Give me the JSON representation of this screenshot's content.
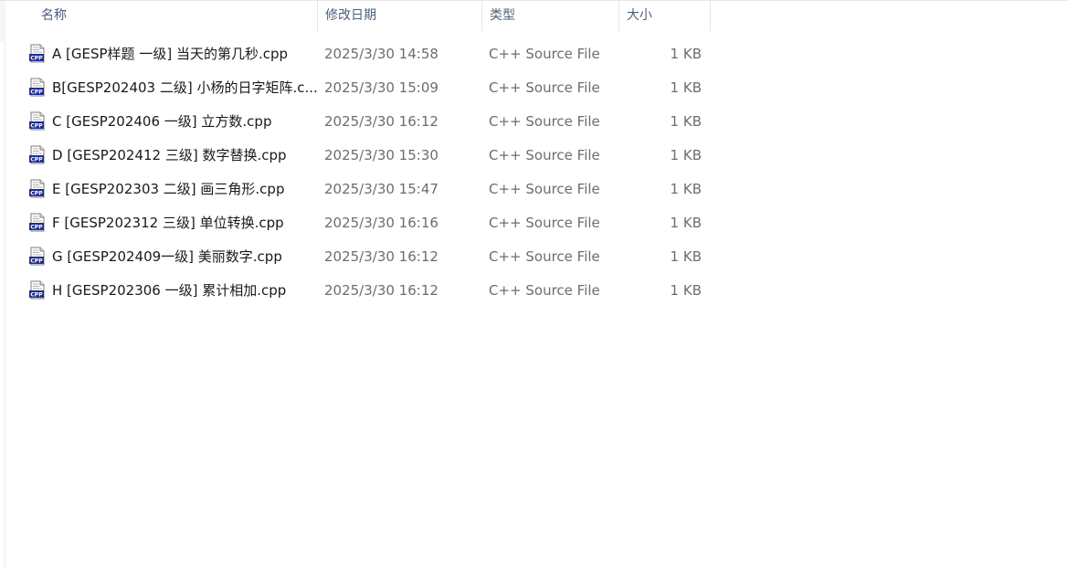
{
  "columns": {
    "name": "名称",
    "date": "修改日期",
    "type": "类型",
    "size": "大小"
  },
  "icons": {
    "file": "cpp-file-icon",
    "sort": "sort-ascending-icon"
  },
  "colors": {
    "header_text": "#4c607a",
    "name_text": "#1a1a1a",
    "meta_text": "#6d6d6d",
    "icon_badge": "#1f2f8f"
  },
  "files": [
    {
      "name": "A [GESP样题 一级] 当天的第几秒.cpp",
      "date": "2025/3/30 14:58",
      "type": "C++ Source File",
      "size": "1 KB"
    },
    {
      "name": "B[GESP202403 二级] 小杨的日字矩阵.c...",
      "date": "2025/3/30 15:09",
      "type": "C++ Source File",
      "size": "1 KB"
    },
    {
      "name": "C [GESP202406 一级] 立方数.cpp",
      "date": "2025/3/30 16:12",
      "type": "C++ Source File",
      "size": "1 KB"
    },
    {
      "name": "D [GESP202412 三级] 数字替换.cpp",
      "date": "2025/3/30 15:30",
      "type": "C++ Source File",
      "size": "1 KB"
    },
    {
      "name": "E [GESP202303 二级] 画三角形.cpp",
      "date": "2025/3/30 15:47",
      "type": "C++ Source File",
      "size": "1 KB"
    },
    {
      "name": "F [GESP202312 三级] 单位转换.cpp",
      "date": "2025/3/30 16:16",
      "type": "C++ Source File",
      "size": "1 KB"
    },
    {
      "name": "G [GESP202409一级] 美丽数字.cpp",
      "date": "2025/3/30 16:12",
      "type": "C++ Source File",
      "size": "1 KB"
    },
    {
      "name": "H [GESP202306 一级] 累计相加.cpp",
      "date": "2025/3/30 16:12",
      "type": "C++ Source File",
      "size": "1 KB"
    }
  ]
}
